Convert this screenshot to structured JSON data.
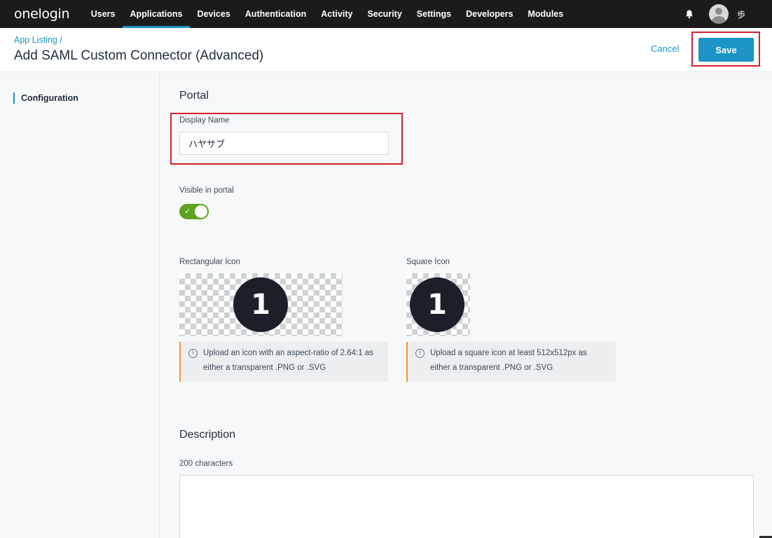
{
  "brand": {
    "logo_text": "onelogin",
    "accent": "#1c94c6",
    "nav_bg": "#1b1b1b"
  },
  "nav": {
    "items": [
      {
        "label": "Users"
      },
      {
        "label": "Applications",
        "active": true
      },
      {
        "label": "Devices"
      },
      {
        "label": "Authentication"
      },
      {
        "label": "Activity"
      },
      {
        "label": "Security"
      },
      {
        "label": "Settings"
      },
      {
        "label": "Developers"
      },
      {
        "label": "Modules"
      }
    ],
    "user_name": "歩",
    "bell_icon": "bell-icon",
    "avatar_icon": "user-avatar-icon"
  },
  "header": {
    "breadcrumb": "App Listing /",
    "title": "Add SAML Custom Connector (Advanced)",
    "cancel_label": "Cancel",
    "save_label": "Save"
  },
  "sidebar": {
    "items": [
      {
        "label": "Configuration",
        "active": true
      }
    ]
  },
  "portal": {
    "section_title": "Portal",
    "display_name_label": "Display Name",
    "display_name_value": "ハヤサブ",
    "visible_label": "Visible in portal",
    "visible_in_portal": true,
    "rect_icon_label": "Rectangular Icon",
    "square_icon_label": "Square Icon",
    "icon_glyph": "1",
    "rect_info": "Upload an icon with an aspect-ratio of 2.64:1 as either a transparent .PNG or .SVG",
    "square_info": "Upload a square icon at least 512x512px as either a transparent .PNG or .SVG"
  },
  "description": {
    "section_title": "Description",
    "char_limit_label": "200 characters",
    "value": ""
  }
}
